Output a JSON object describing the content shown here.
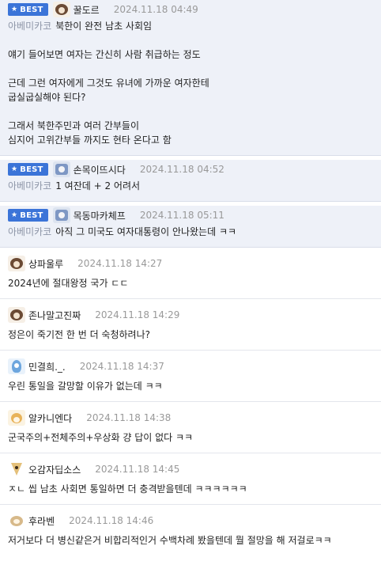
{
  "best_label": "BEST",
  "comments": [
    {
      "best": true,
      "avatar": "dog-face-icon",
      "nick": "꿀도르",
      "date": "2024.11.18 04:49",
      "mention": "아베미카코",
      "lines": [
        "북한이 완전 남초 사회임",
        "",
        "얘기 들어보면 여자는 간신히 사람 취급하는 정도",
        "",
        "근데 그런 여자에게 그것도 유녀에 가까운 여자한테",
        "굽실굽실해야 된다?",
        "",
        "그래서 북한주민과 여러 간부들이",
        "심지어 고위간부들 까지도 현타 온다고 함"
      ]
    },
    {
      "best": true,
      "avatar": "blue-character-icon",
      "nick": "손목이뜨시다",
      "date": "2024.11.18 04:52",
      "mention": "아베미카코",
      "lines": [
        "1 여잔데 + 2 어려서"
      ]
    },
    {
      "best": true,
      "avatar": "blue-character-icon",
      "nick": "목동마카체프",
      "date": "2024.11.18 05:11",
      "mention": "아베미카코",
      "lines": [
        "아직 그 미국도 여자대통령이 안나왔는데 ㅋㅋ"
      ]
    },
    {
      "best": false,
      "avatar": "dog-face-icon",
      "nick": "상파울루",
      "date": "2024.11.18 14:27",
      "mention": "",
      "lines": [
        "2024년에 절대왕정 국가 ㄷㄷ"
      ]
    },
    {
      "best": false,
      "avatar": "dog-face-icon",
      "nick": "존나말고진짜",
      "date": "2024.11.18 14:29",
      "mention": "",
      "lines": [
        "정은이 죽기전 한 번 더 숙청하려나?"
      ]
    },
    {
      "best": false,
      "avatar": "cold-face-icon",
      "nick": "민결희._.",
      "date": "2024.11.18 14:37",
      "mention": "",
      "lines": [
        "우린 통일을 갈망할 이유가 없는데 ㅋㅋ"
      ]
    },
    {
      "best": false,
      "avatar": "shiba-dog-icon",
      "nick": "알카니엔다",
      "date": "2024.11.18 14:38",
      "mention": "",
      "lines": [
        "군국주의+전체주의+우상화 걍 답이 없다 ㅋㅋ"
      ]
    },
    {
      "best": false,
      "avatar": "fox-face-icon",
      "nick": "오감자딥소스",
      "date": "2024.11.18 14:45",
      "mention": "",
      "lines": [
        "ㅈㄴ 씹 남초 사회면 통일하면 더 충격받을텐데 ㅋㅋㅋㅋㅋㅋ"
      ]
    },
    {
      "best": false,
      "avatar": "puppy-face-icon",
      "nick": "후라벤",
      "date": "2024.11.18 14:46",
      "mention": "",
      "lines": [
        "저거보다 더 병신같은거 비합리적인거 수백차례 봤을텐데 뭘 절망을 해 저걸로ㅋㅋ"
      ]
    }
  ]
}
